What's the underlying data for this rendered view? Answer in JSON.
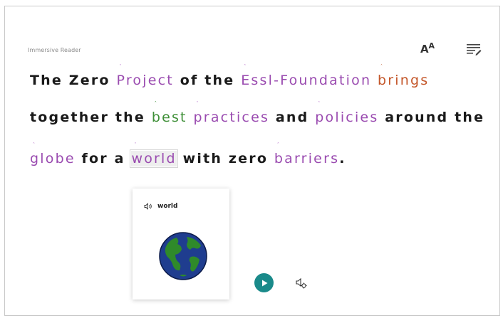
{
  "app": {
    "title": "Immersive Reader"
  },
  "toolbar": {
    "text_prefs_big": "A",
    "text_prefs_small": "A"
  },
  "reader": {
    "line1": [
      {
        "text": "The ",
        "pos": ""
      },
      {
        "text": "Zero ",
        "pos": ""
      },
      {
        "text": "Project",
        "pos": "noun"
      },
      {
        "text": " of the ",
        "pos": ""
      },
      {
        "text": "Essl-Foundation",
        "pos": "noun"
      },
      {
        "text": " ",
        "pos": ""
      },
      {
        "text": "brings",
        "pos": "verb"
      }
    ],
    "line2": [
      {
        "text": "together the ",
        "pos": ""
      },
      {
        "text": "best",
        "pos": "adj"
      },
      {
        "text": " ",
        "pos": ""
      },
      {
        "text": "practices",
        "pos": "noun"
      },
      {
        "text": " and ",
        "pos": ""
      },
      {
        "text": "policies",
        "pos": "noun"
      },
      {
        "text": " around the",
        "pos": ""
      }
    ],
    "line3": [
      {
        "text": "globe",
        "pos": "noun"
      },
      {
        "text": " for a ",
        "pos": ""
      },
      {
        "text": "world",
        "pos": "noun",
        "selected": true
      },
      {
        "text": " with zero ",
        "pos": ""
      },
      {
        "text": "barriers",
        "pos": "noun"
      },
      {
        "text": ".",
        "pos": ""
      }
    ]
  },
  "picture_dictionary": {
    "word": "world",
    "icon": "speaker-icon",
    "image": "globe-icon"
  },
  "controls": {
    "play_icon": "play-icon",
    "voice_icon": "voice-settings-icon"
  },
  "colors": {
    "noun": "#9a4bb0",
    "verb": "#c4572a",
    "adjective": "#3e8f37",
    "play": "#1a8a8a"
  }
}
